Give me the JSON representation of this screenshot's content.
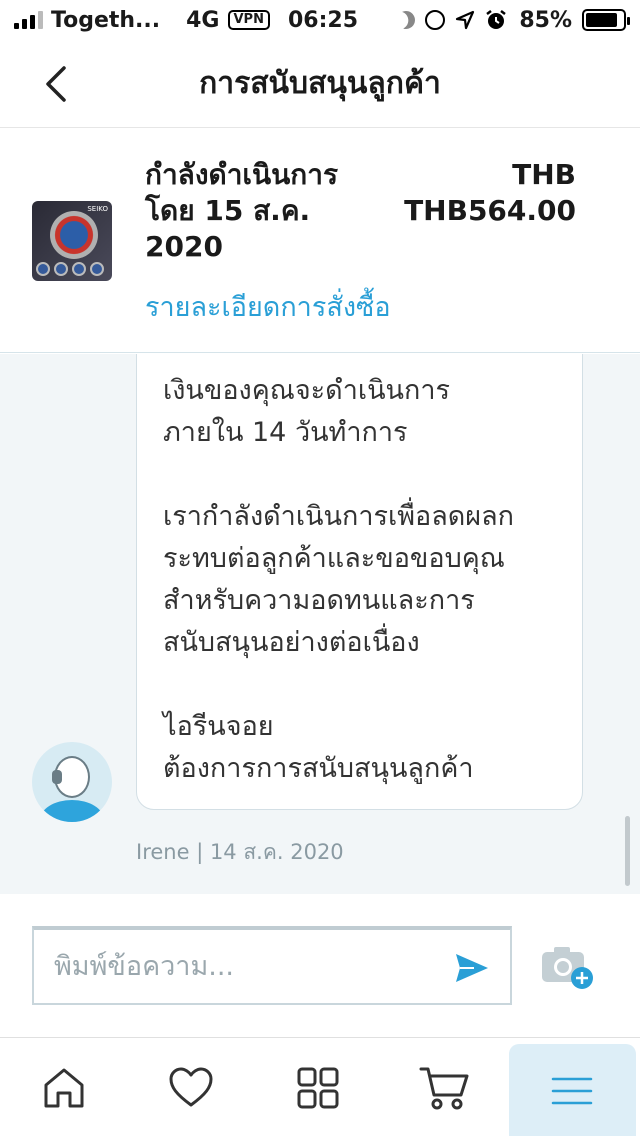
{
  "status_bar": {
    "carrier": "Togeth...",
    "network": "4G",
    "vpn": "VPN",
    "time": "06:25",
    "battery": "85%",
    "battery_level": 0.85
  },
  "nav": {
    "title": "การสนับสนุนลูกค้า"
  },
  "order": {
    "status_line1": "กำลังดำเนินการ",
    "status_line2": "โดย 15 ส.ค.",
    "status_line3": "2020",
    "currency": "THB",
    "amount": "THB564.00",
    "details_link": "รายละเอียดการสั่งซื้อ",
    "thumb_brand": "SEIKO"
  },
  "chat": {
    "message_paragraphs": [
      "เงินของคุณจะดำเนินการ\nภายใน 14 วันทำการ",
      "เรากำลังดำเนินการเพื่อลดผลก\nระทบต่อลูกค้าและขอขอบคุณ\nสำหรับความอดทนและการ\nสนับสนุนอย่างต่อเนื่อง",
      "ไอรีนจอย\nต้องการการสนับสนุนลูกค้า"
    ],
    "meta": "Irene | 14 ส.ค. 2020"
  },
  "composer": {
    "placeholder": "พิมพ์ข้อความ..."
  },
  "tabbar": {
    "items": [
      "home-icon",
      "heart-icon",
      "grid-icon",
      "cart-icon",
      "menu-icon"
    ],
    "active": "menu-icon"
  },
  "colors": {
    "accent": "#2a9fd6",
    "chat_bg": "#f2f6f8",
    "active_tab_bg": "#ddeef7"
  }
}
